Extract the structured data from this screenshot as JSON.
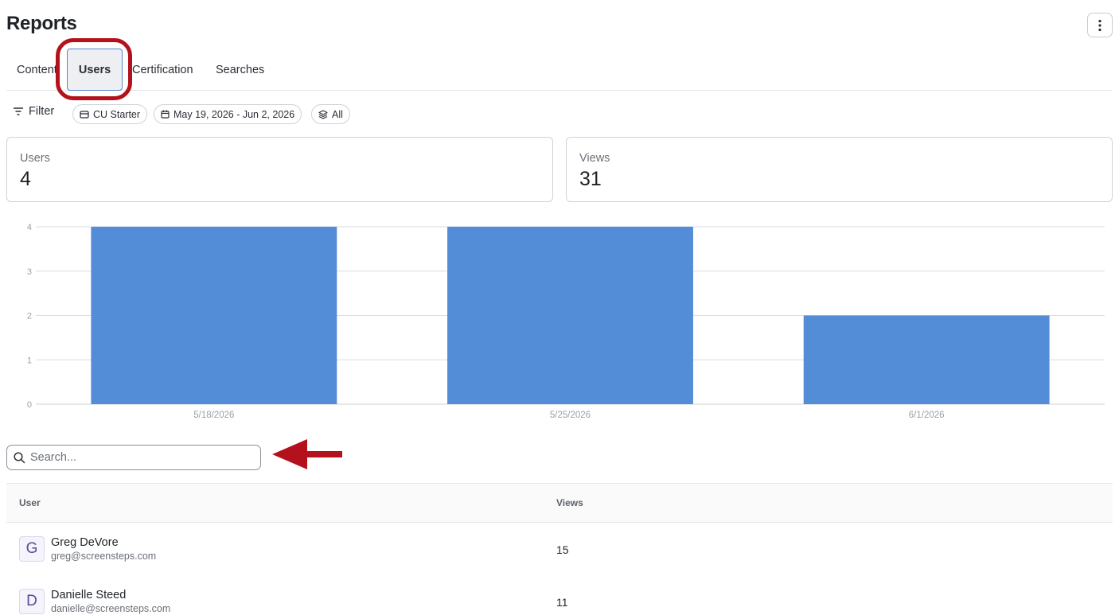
{
  "page": {
    "title": "Reports"
  },
  "tabs": [
    {
      "label": "Content",
      "active": false
    },
    {
      "label": "Users",
      "active": true
    },
    {
      "label": "Certification",
      "active": false
    },
    {
      "label": "Searches",
      "active": false
    }
  ],
  "filters": {
    "filter_label": "Filter",
    "chips": [
      {
        "label": "CU Starter",
        "icon": "site-icon"
      },
      {
        "label": "May 19, 2026 - Jun 2, 2026",
        "icon": "calendar-icon"
      },
      {
        "label": "All",
        "icon": "layers-icon"
      }
    ]
  },
  "stats": {
    "users": {
      "label": "Users",
      "value": "4"
    },
    "views": {
      "label": "Views",
      "value": "31"
    }
  },
  "chart_data": {
    "type": "bar",
    "categories": [
      "5/18/2026",
      "5/25/2026",
      "6/1/2026"
    ],
    "values": [
      4,
      4,
      2
    ],
    "yticks": [
      0,
      1,
      2,
      3,
      4
    ],
    "ylim": [
      0,
      4
    ],
    "grid": true,
    "bar_color": "#538dd8",
    "title": "",
    "xlabel": "",
    "ylabel": ""
  },
  "search": {
    "placeholder": "Search..."
  },
  "table": {
    "columns": {
      "user": "User",
      "views": "Views"
    },
    "rows": [
      {
        "initial": "G",
        "name": "Greg DeVore",
        "email": "greg@screensteps.com",
        "views": "15"
      },
      {
        "initial": "D",
        "name": "Danielle Steed",
        "email": "danielle@screensteps.com",
        "views": "11"
      }
    ]
  },
  "colors": {
    "accent": "#538dd8",
    "annotation": "#b3121c",
    "active_tab_border": "#5b86c9"
  }
}
